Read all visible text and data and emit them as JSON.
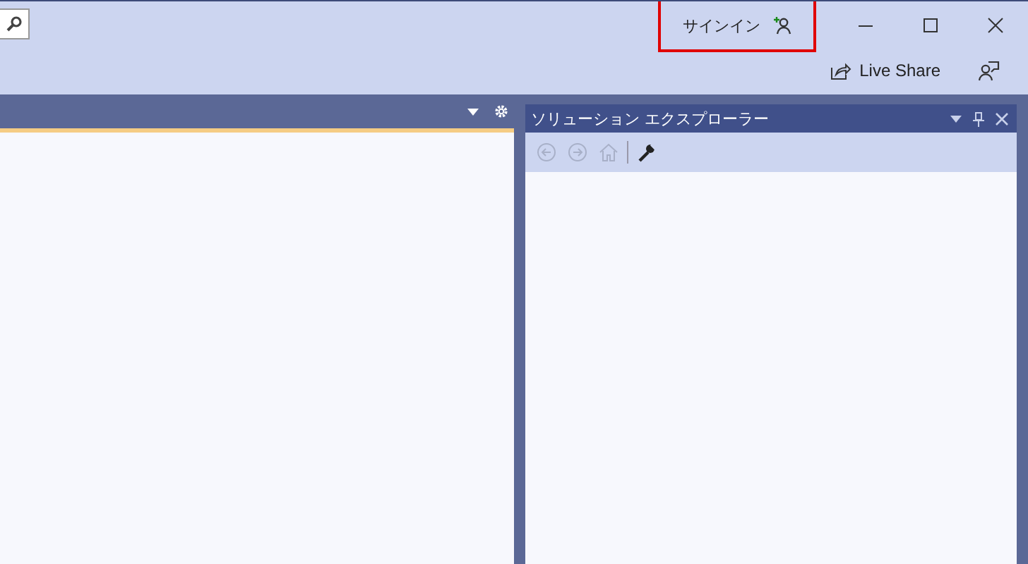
{
  "title_bar": {
    "sign_in": {
      "label": "サインイン",
      "highlighted": true
    },
    "live_share": {
      "label": "Live Share"
    }
  },
  "solution_explorer": {
    "title": "ソリューション エクスプローラー",
    "toolbar": [
      {
        "kind": "back",
        "disabled": true
      },
      {
        "kind": "forward",
        "disabled": true
      },
      {
        "kind": "home",
        "disabled": true
      },
      {
        "kind": "separator"
      },
      {
        "kind": "wrench",
        "disabled": false
      }
    ]
  }
}
